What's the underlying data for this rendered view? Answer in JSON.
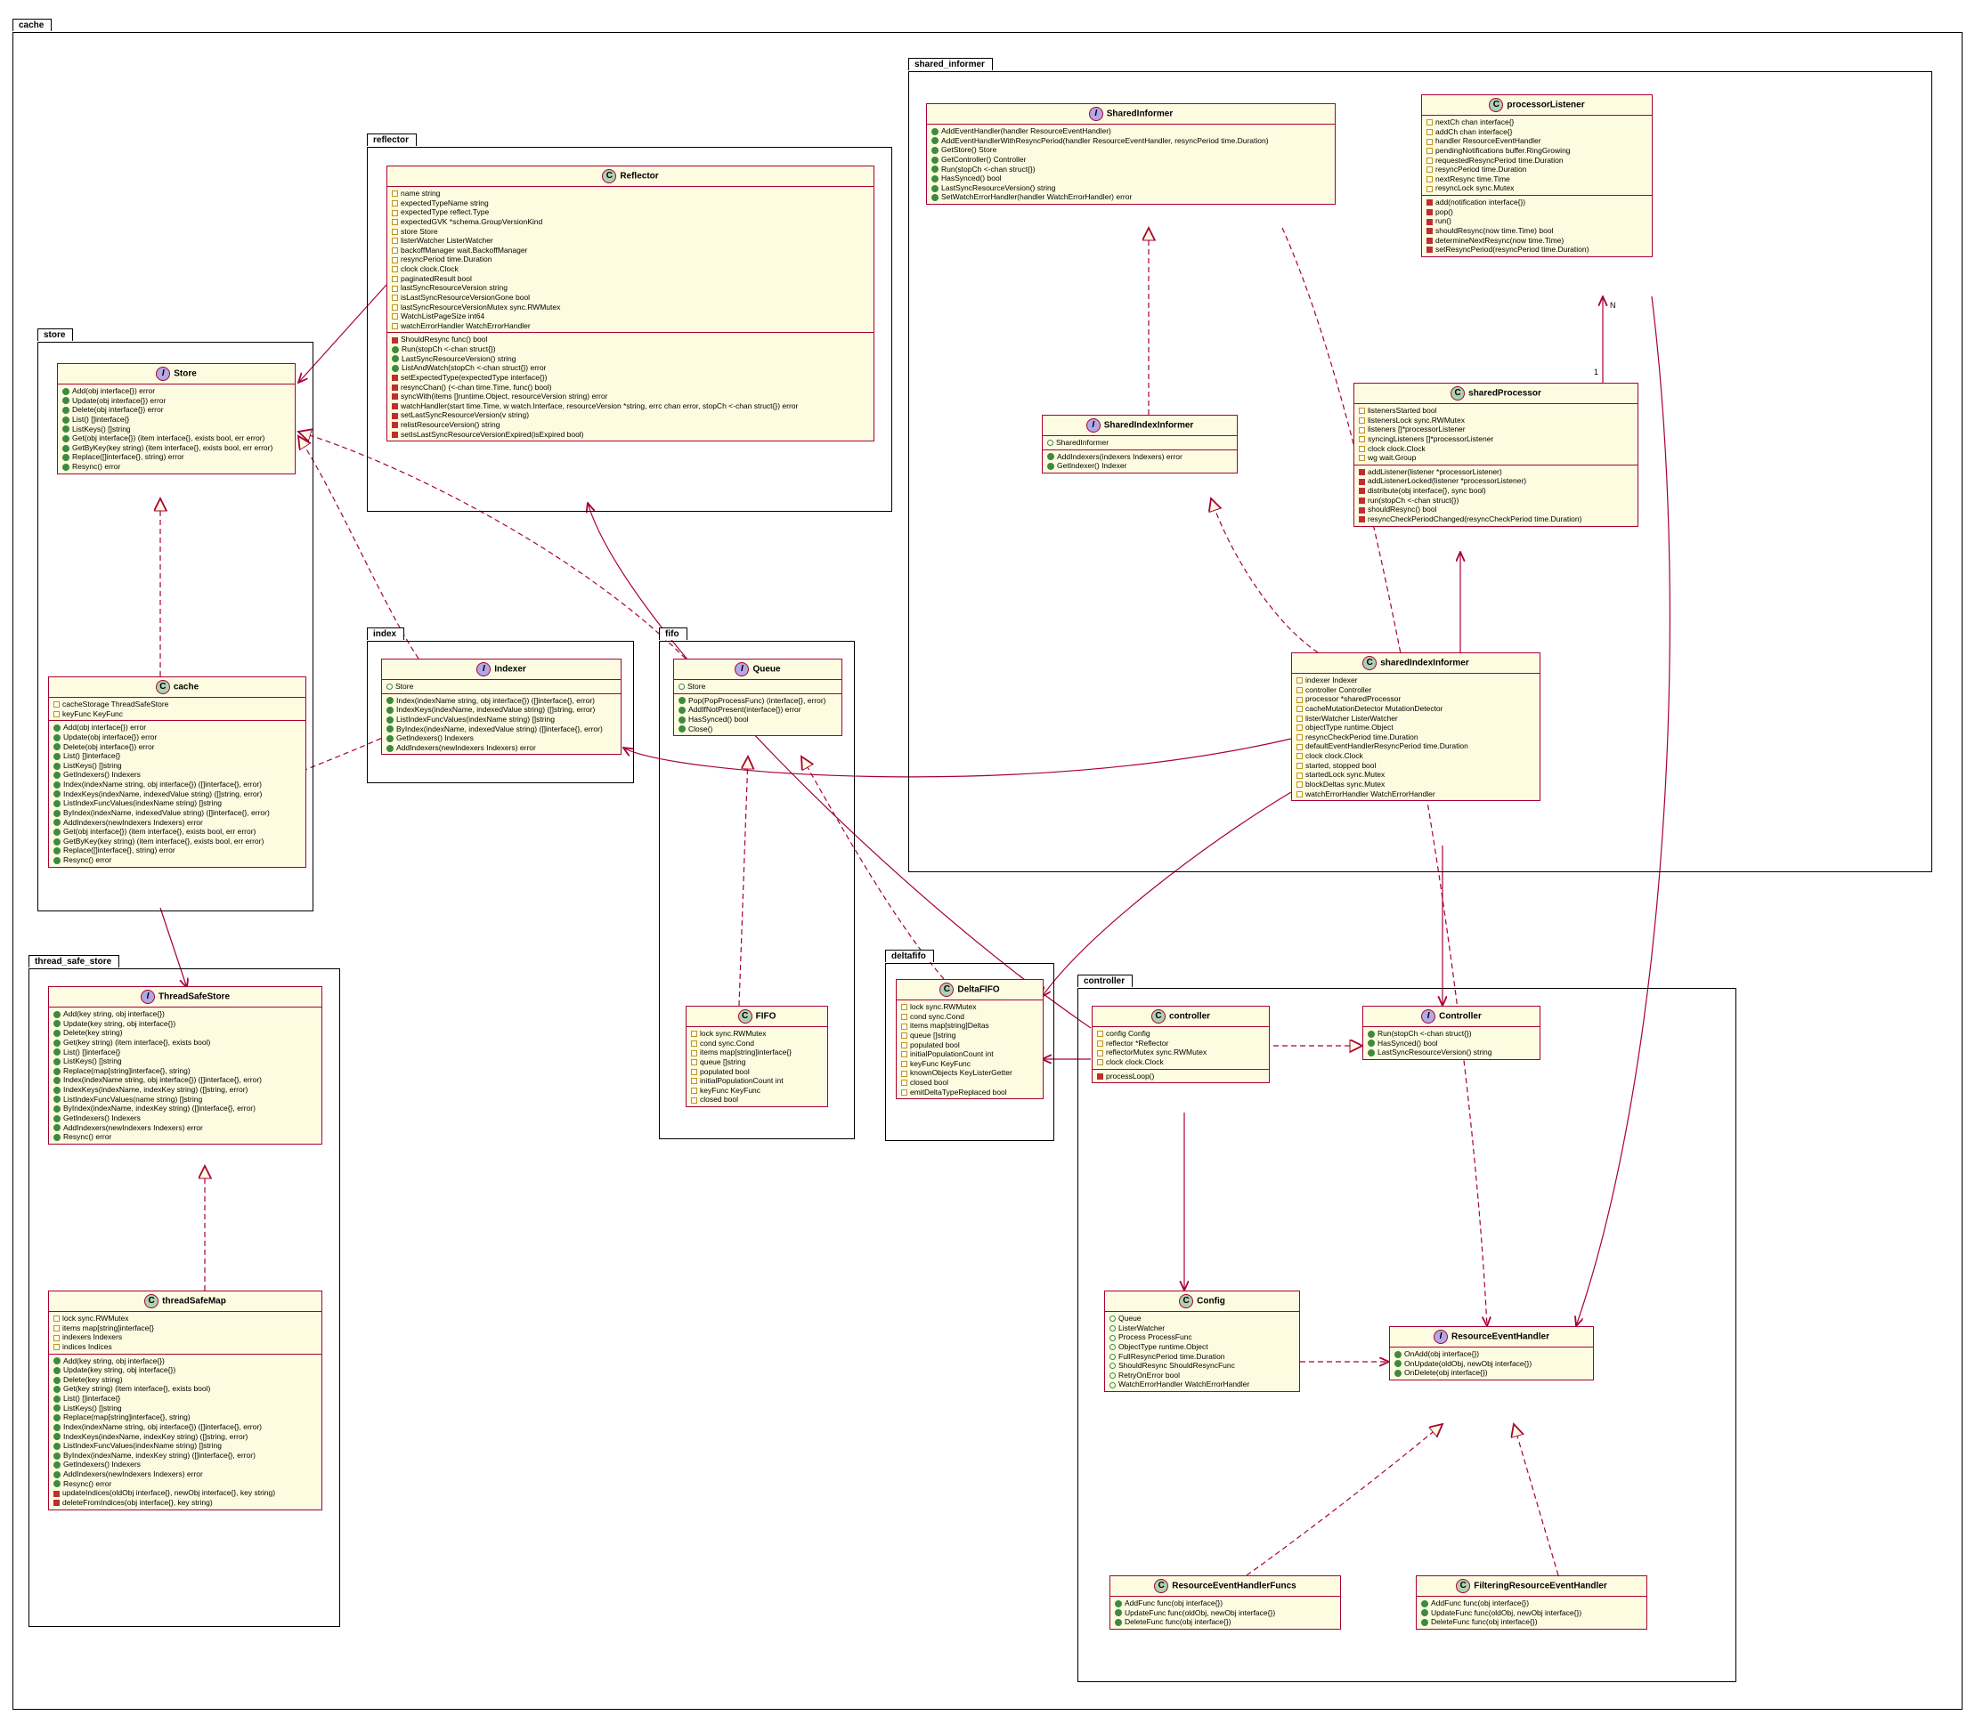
{
  "packages": {
    "cache": "cache",
    "store": "store",
    "reflector": "reflector",
    "index": "index",
    "fifo": "fifo",
    "thread_safe_store": "thread_safe_store",
    "deltafifo": "deltafifo",
    "controller": "controller",
    "shared_informer": "shared_informer"
  },
  "classes": {
    "Store": {
      "title": "Store",
      "kind": "I",
      "methods_pub": [
        "Add(obj interface{}) error",
        "Update(obj interface{}) error",
        "Delete(obj interface{}) error",
        "List() []interface{}",
        "ListKeys() []string",
        "Get(obj interface{}) (item interface{}, exists bool, err error)",
        "GetByKey(key string) (item interface{}, exists bool, err error)",
        "Replace([]interface{}, string) error",
        "Resync() error"
      ]
    },
    "cacheClass": {
      "title": "cache",
      "kind": "C",
      "fields": [
        "cacheStorage ThreadSafeStore",
        "keyFunc KeyFunc"
      ],
      "methods_pub": [
        "Add(obj interface{}) error",
        "Update(obj interface{}) error",
        "Delete(obj interface{}) error",
        "List() []interface{}",
        "ListKeys() []string",
        "GetIndexers() Indexers",
        "Index(indexName string, obj interface{}) ([]interface{}, error)",
        "IndexKeys(indexName, indexedValue string) ([]string, error)",
        "ListIndexFuncValues(indexName string) []string",
        "ByIndex(indexName, indexedValue string) ([]interface{}, error)",
        "AddIndexers(newIndexers Indexers) error",
        "Get(obj interface{}) (item interface{}, exists bool, err error)",
        "GetByKey(key string) (item interface{}, exists bool, err error)",
        "Replace([]interface{}, string) error",
        "Resync() error"
      ]
    },
    "Reflector": {
      "title": "Reflector",
      "kind": "C",
      "fields": [
        "name string",
        "expectedTypeName string",
        "expectedType reflect.Type",
        "expectedGVK *schema.GroupVersionKind",
        "store Store",
        "listerWatcher ListerWatcher",
        "backoffManager wait.BackoffManager",
        "resyncPeriod time.Duration",
        "clock clock.Clock",
        "paginatedResult bool",
        "lastSyncResourceVersion string",
        "isLastSyncResourceVersionGone bool",
        "lastSyncResourceVersionMutex sync.RWMutex",
        "WatchListPageSize int64",
        "watchErrorHandler WatchErrorHandler"
      ],
      "methods_priv": [
        "ShouldResync func() bool"
      ],
      "methods_pub2": [
        "Run(stopCh <-chan struct{})",
        "LastSyncResourceVersion() string",
        "ListAndWatch(stopCh <-chan struct{}) error"
      ],
      "methods_priv2": [
        "setExpectedType(expectedType interface{})",
        "resyncChan() (<-chan time.Time, func() bool)",
        "syncWith(items []runtime.Object, resourceVersion string) error",
        "watchHandler(start time.Time, w watch.Interface, resourceVersion *string, errc chan error, stopCh <-chan struct{}) error",
        "setLastSyncResourceVersion(v string)",
        "relistResourceVersion() string",
        "setIsLastSyncResourceVersionExpired(isExpired bool)"
      ]
    },
    "Indexer": {
      "title": "Indexer",
      "kind": "I",
      "fields_hollow": [
        "Store"
      ],
      "methods_pub": [
        "Index(indexName string, obj interface{}) ([]interface{}, error)",
        "IndexKeys(indexName, indexedValue string) ([]string, error)",
        "ListIndexFuncValues(indexName string) []string",
        "ByIndex(indexName, indexedValue string) ([]interface{}, error)",
        "GetIndexers() Indexers",
        "AddIndexers(newIndexers Indexers) error"
      ]
    },
    "Queue": {
      "title": "Queue",
      "kind": "I",
      "fields_hollow": [
        "Store"
      ],
      "methods_pub": [
        "Pop(PopProcessFunc) (interface{}, error)",
        "AddIfNotPresent(interface{}) error",
        "HasSynced() bool",
        "Close()"
      ]
    },
    "ThreadSafeStore": {
      "title": "ThreadSafeStore",
      "kind": "I",
      "methods_pub": [
        "Add(key string, obj interface{})",
        "Update(key string, obj interface{})",
        "Delete(key string)",
        "Get(key string) (item interface{}, exists bool)",
        "List() []interface{}",
        "ListKeys() []string",
        "Replace(map[string]interface{}, string)",
        "Index(indexName string, obj interface{}) ([]interface{}, error)",
        "IndexKeys(indexName, indexKey string) ([]string, error)",
        "ListIndexFuncValues(name string) []string",
        "ByIndex(indexName, indexKey string) ([]interface{}, error)",
        "GetIndexers() Indexers",
        "AddIndexers(newIndexers Indexers) error",
        "Resync() error"
      ]
    },
    "threadSafeMap": {
      "title": "threadSafeMap",
      "kind": "C",
      "fields": [
        "lock  sync.RWMutex",
        "items map[string]interface{}",
        "indexers Indexers",
        "indices Indices"
      ],
      "methods_pub": [
        "Add(key string, obj interface{})",
        "Update(key string, obj interface{})",
        "Delete(key string)",
        "Get(key string) (item interface{}, exists bool)",
        "List() []interface{}",
        "ListKeys() []string",
        "Replace(map[string]interface{}, string)",
        "Index(indexName string, obj interface{}) ([]interface{}, error)",
        "IndexKeys(indexName, indexKey string) ([]string, error)",
        "ListIndexFuncValues(indexName string) []string",
        "ByIndex(indexName, indexKey string) ([]interface{}, error)",
        "GetIndexers() Indexers",
        "AddIndexers(newIndexers Indexers) error",
        "Resync() error"
      ],
      "methods_priv": [
        "updateIndices(oldObj interface{}, newObj interface{}, key string)",
        "deleteFromIndices(obj interface{}, key string)"
      ]
    },
    "FIFO": {
      "title": "FIFO",
      "kind": "C",
      "fields": [
        "lock sync.RWMutex",
        "cond sync.Cond",
        "items map[string]interface{}",
        "queue []string",
        "populated bool",
        "initialPopulationCount int",
        "keyFunc KeyFunc",
        "closed bool"
      ]
    },
    "DeltaFIFO": {
      "title": "DeltaFIFO",
      "kind": "C",
      "fields": [
        "lock sync.RWMutex",
        "cond sync.Cond",
        "items map[string]Deltas",
        "queue []string",
        "populated bool",
        "initialPopulationCount int",
        "keyFunc KeyFunc",
        "knownObjects KeyListerGetter",
        "closed bool",
        "emitDeltaTypeReplaced bool"
      ]
    },
    "controllerClass": {
      "title": "controller",
      "kind": "C",
      "fields": [
        "config         Config",
        "reflector      *Reflector",
        "reflectorMutex sync.RWMutex",
        "clock          clock.Clock"
      ],
      "methods_priv": [
        "processLoop()"
      ]
    },
    "Controller": {
      "title": "Controller",
      "kind": "I",
      "methods_pub": [
        "Run(stopCh <-chan struct{})",
        "HasSynced() bool",
        "LastSyncResourceVersion() string"
      ]
    },
    "Config": {
      "title": "Config",
      "kind": "C",
      "fields_hollow": [
        "Queue",
        "ListerWatcher",
        "Process ProcessFunc",
        "ObjectType runtime.Object",
        "FullResyncPeriod time.Duration",
        "ShouldResync ShouldResyncFunc",
        "RetryOnError bool",
        "WatchErrorHandler WatchErrorHandler"
      ]
    },
    "ResourceEventHandler": {
      "title": "ResourceEventHandler",
      "kind": "I",
      "methods_pub": [
        "OnAdd(obj interface{})",
        "OnUpdate(oldObj, newObj interface{})",
        "OnDelete(obj interface{})"
      ]
    },
    "ResourceEventHandlerFuncs": {
      "title": "ResourceEventHandlerFuncs",
      "kind": "C",
      "methods_pub": [
        "AddFunc    func(obj interface{})",
        "UpdateFunc func(oldObj, newObj interface{})",
        "DeleteFunc func(obj interface{})"
      ]
    },
    "FilteringResourceEventHandler": {
      "title": "FilteringResourceEventHandler",
      "kind": "C",
      "methods_pub": [
        "AddFunc    func(obj interface{})",
        "UpdateFunc func(oldObj, newObj interface{})",
        "DeleteFunc func(obj interface{})"
      ]
    },
    "SharedInformer": {
      "title": "SharedInformer",
      "kind": "I",
      "methods_pub": [
        "AddEventHandler(handler ResourceEventHandler)",
        "AddEventHandlerWithResyncPeriod(handler ResourceEventHandler, resyncPeriod time.Duration)",
        "GetStore() Store",
        "GetController() Controller",
        "Run(stopCh <-chan struct{})",
        "HasSynced() bool",
        "LastSyncResourceVersion() string",
        "SetWatchErrorHandler(handler WatchErrorHandler) error"
      ]
    },
    "SharedIndexInformer": {
      "title": "SharedIndexInformer",
      "kind": "I",
      "fields_hollow": [
        "SharedInformer"
      ],
      "methods_pub": [
        "AddIndexers(indexers Indexers) error",
        "GetIndexer() Indexer"
      ]
    },
    "processorListener": {
      "title": "processorListener",
      "kind": "C",
      "fields": [
        "nextCh chan interface{}",
        "addCh  chan interface{}",
        "handler ResourceEventHandler",
        "pendingNotifications buffer.RingGrowing",
        "requestedResyncPeriod time.Duration",
        "resyncPeriod time.Duration",
        "nextResync time.Time",
        "resyncLock sync.Mutex"
      ],
      "methods_priv": [
        "add(notification interface{})",
        "pop()",
        "run()",
        "shouldResync(now time.Time) bool",
        "determineNextResync(now time.Time)",
        "setResyncPeriod(resyncPeriod time.Duration)"
      ]
    },
    "sharedProcessor": {
      "title": "sharedProcessor",
      "kind": "C",
      "fields": [
        "listenersStarted bool",
        "listenersLock    sync.RWMutex",
        "listeners        []*processorListener",
        "syncingListeners []*processorListener",
        "clock            clock.Clock",
        "wg               wait.Group"
      ],
      "methods_priv": [
        "addListener(listener *processorListener)",
        "addListenerLocked(listener *processorListener)",
        "distribute(obj interface{}, sync bool)",
        "run(stopCh <-chan struct{})",
        "shouldResync() bool",
        "resyncCheckPeriodChanged(resyncCheckPeriod time.Duration)"
      ]
    },
    "sharedIndexInformer": {
      "title": "sharedIndexInformer",
      "kind": "C",
      "fields": [
        "indexer    Indexer",
        "controller Controller",
        "processor             *sharedProcessor",
        "cacheMutationDetector MutationDetector",
        "listerWatcher ListerWatcher",
        "objectType runtime.Object",
        "resyncCheckPeriod time.Duration",
        "defaultEventHandlerResyncPeriod time.Duration",
        "clock clock.Clock",
        "started, stopped bool",
        "startedLock      sync.Mutex",
        "blockDeltas sync.Mutex",
        "watchErrorHandler WatchErrorHandler"
      ]
    }
  },
  "mult": {
    "one": "1",
    "many": "N"
  }
}
